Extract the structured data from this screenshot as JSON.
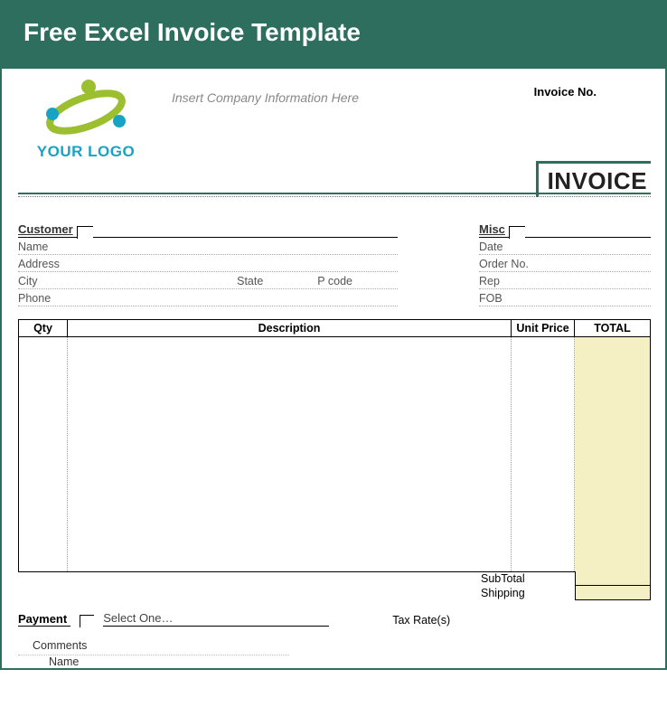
{
  "banner": {
    "title": "Free Excel Invoice Template"
  },
  "logo": {
    "caption": "YOUR LOGO"
  },
  "company_hint": "Insert Company Information Here",
  "invoice_no_label": "Invoice No.",
  "title": "INVOICE",
  "customer": {
    "heading": "Customer",
    "name_label": "Name",
    "address_label": "Address",
    "city_label": "City",
    "state_label": "State",
    "pcode_label": "P code",
    "phone_label": "Phone"
  },
  "misc": {
    "heading": "Misc",
    "date_label": "Date",
    "order_label": "Order No.",
    "rep_label": "Rep",
    "fob_label": "FOB"
  },
  "columns": {
    "qty": "Qty",
    "desc": "Description",
    "unit": "Unit Price",
    "total": "TOTAL"
  },
  "totals": {
    "subtotal": "SubTotal",
    "shipping": "Shipping",
    "tax_rates": "Tax Rate(s)"
  },
  "payment": {
    "heading": "Payment",
    "select_placeholder": "Select One…"
  },
  "comments": {
    "heading": "Comments",
    "name_label": "Name"
  }
}
